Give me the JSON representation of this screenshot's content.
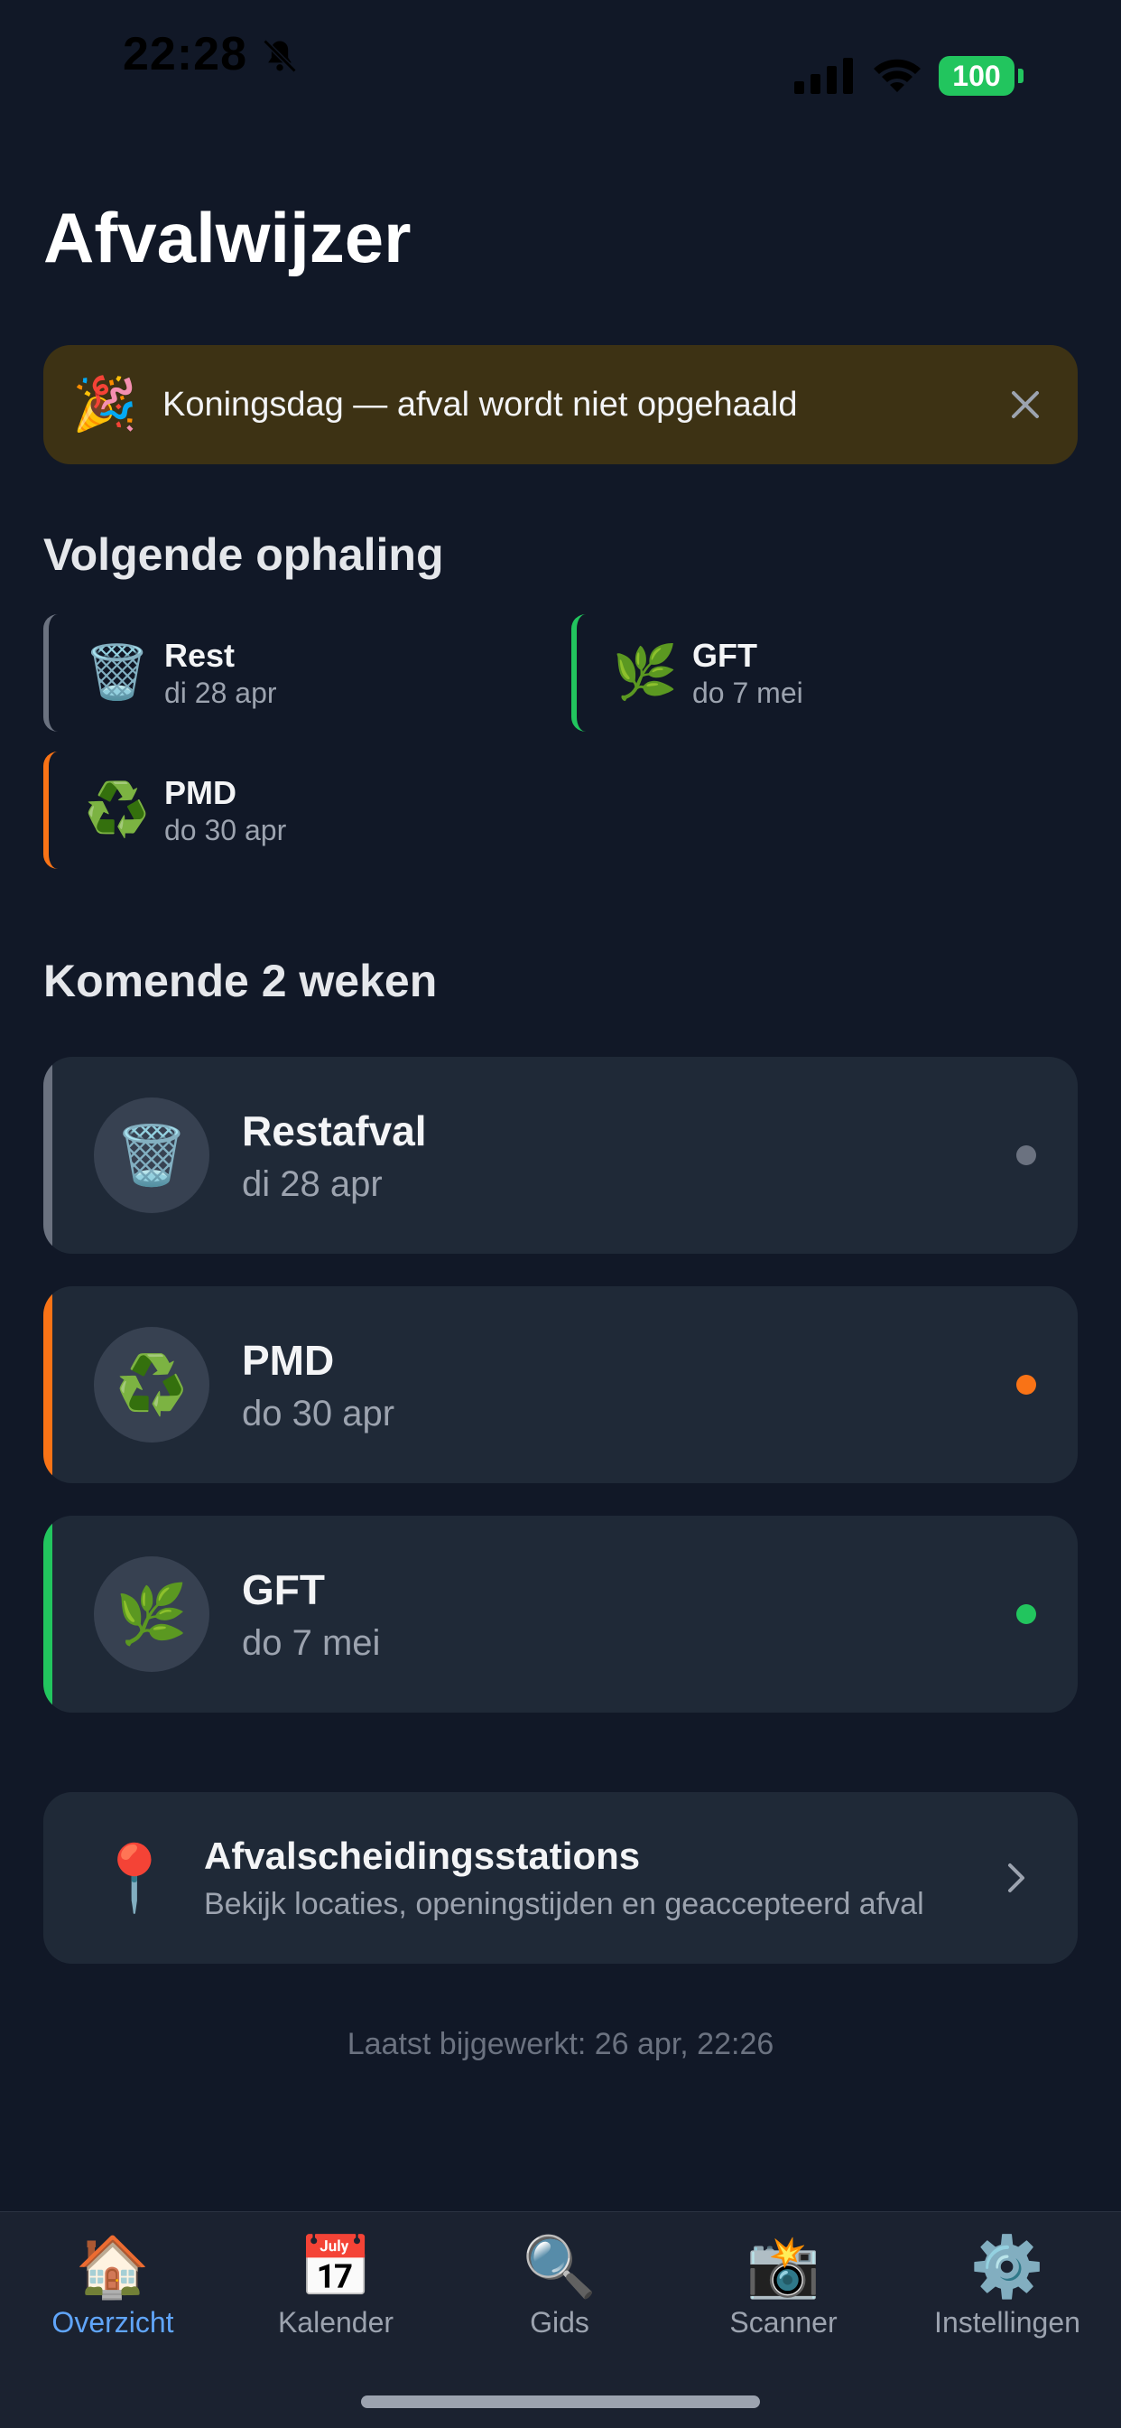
{
  "status_bar": {
    "time": "22:28",
    "battery": "100"
  },
  "app": {
    "title": "Afvalwijzer"
  },
  "banner": {
    "icon": "🎉",
    "text": "Koningsdag — afval wordt niet opgehaald"
  },
  "next_pickup": {
    "title": "Volgende ophaling",
    "items": [
      {
        "name": "Rest",
        "date": "di 28 apr",
        "icon": "🗑️",
        "color": "#6b7280"
      },
      {
        "name": "GFT",
        "date": "do 7 mei",
        "icon": "🌿",
        "color": "#22c55e"
      },
      {
        "name": "PMD",
        "date": "do 30 apr",
        "icon": "♻️",
        "color": "#f97316"
      }
    ]
  },
  "upcoming": {
    "title": "Komende 2 weken",
    "items": [
      {
        "name": "Restafval",
        "date": "di 28 apr",
        "icon": "🗑️",
        "color": "#6b7280"
      },
      {
        "name": "PMD",
        "date": "do 30 apr",
        "icon": "♻️",
        "color": "#f97316"
      },
      {
        "name": "GFT",
        "date": "do 7 mei",
        "icon": "🌿",
        "color": "#22c55e"
      }
    ]
  },
  "stations": {
    "icon": "📍",
    "title": "Afvalscheidingsstations",
    "subtitle": "Bekijk locaties, openingstijden en geaccepteerd afval"
  },
  "last_updated": "Laatst bijgewerkt: 26 apr, 22:26",
  "tabs": [
    {
      "label": "Overzicht",
      "icon": "🏠",
      "active": true
    },
    {
      "label": "Kalender",
      "icon": "📅",
      "active": false
    },
    {
      "label": "Gids",
      "icon": "🔍",
      "active": false
    },
    {
      "label": "Scanner",
      "icon": "📸",
      "active": false
    },
    {
      "label": "Instellingen",
      "icon": "⚙️",
      "active": false
    }
  ]
}
